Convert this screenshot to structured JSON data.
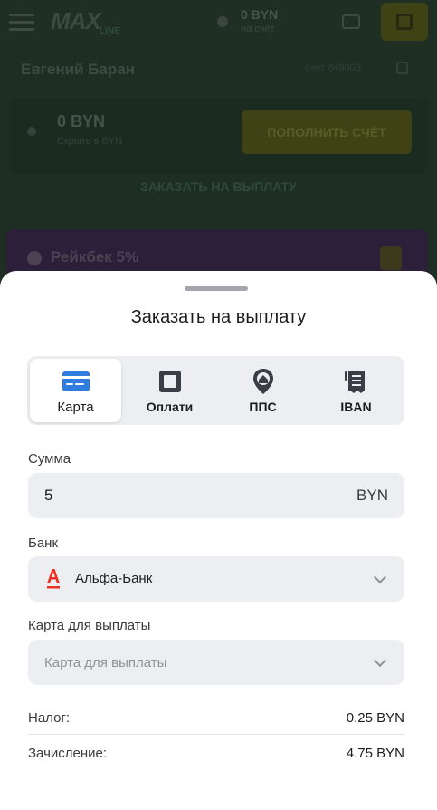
{
  "background": {
    "logo": "MAX",
    "logo_sub": "LINE",
    "top_balance": "0 BYN",
    "top_balance_sub": "на счёт",
    "user_name": "Евгений Баран",
    "account_label": "счёт 849003",
    "balance": "0 BYN",
    "balance_sub": "Скрыть в BYN",
    "deposit_button": "ПОПОЛНИТЬ СЧЁТ",
    "withdraw_link": "ЗАКАЗАТЬ НА ВЫПЛАТУ",
    "cashback": "Рейкбек 5%"
  },
  "sheet": {
    "title": "Заказать на выплату",
    "tabs": [
      {
        "label": "Карта",
        "icon": "card-icon",
        "active": true
      },
      {
        "label": "Оплати",
        "icon": "oplati-icon",
        "active": false
      },
      {
        "label": "ППС",
        "icon": "location-pin-icon",
        "active": false
      },
      {
        "label": "IBAN",
        "icon": "iban-icon",
        "active": false
      }
    ],
    "amount": {
      "label": "Сумма",
      "value": "5",
      "currency": "BYN"
    },
    "bank": {
      "label": "Банк",
      "value": "Альфа-Банк"
    },
    "card": {
      "label": "Карта для выплаты",
      "placeholder": "Карта для выплаты"
    },
    "summary": {
      "tax_label": "Налог:",
      "tax_value": "0.25 BYN",
      "credit_label": "Зачисление:",
      "credit_value": "4.75 BYN"
    }
  },
  "colors": {
    "accent_blue": "#2f7de1",
    "alfa_red": "#ef3124",
    "icon_dark": "#3a3f47"
  }
}
